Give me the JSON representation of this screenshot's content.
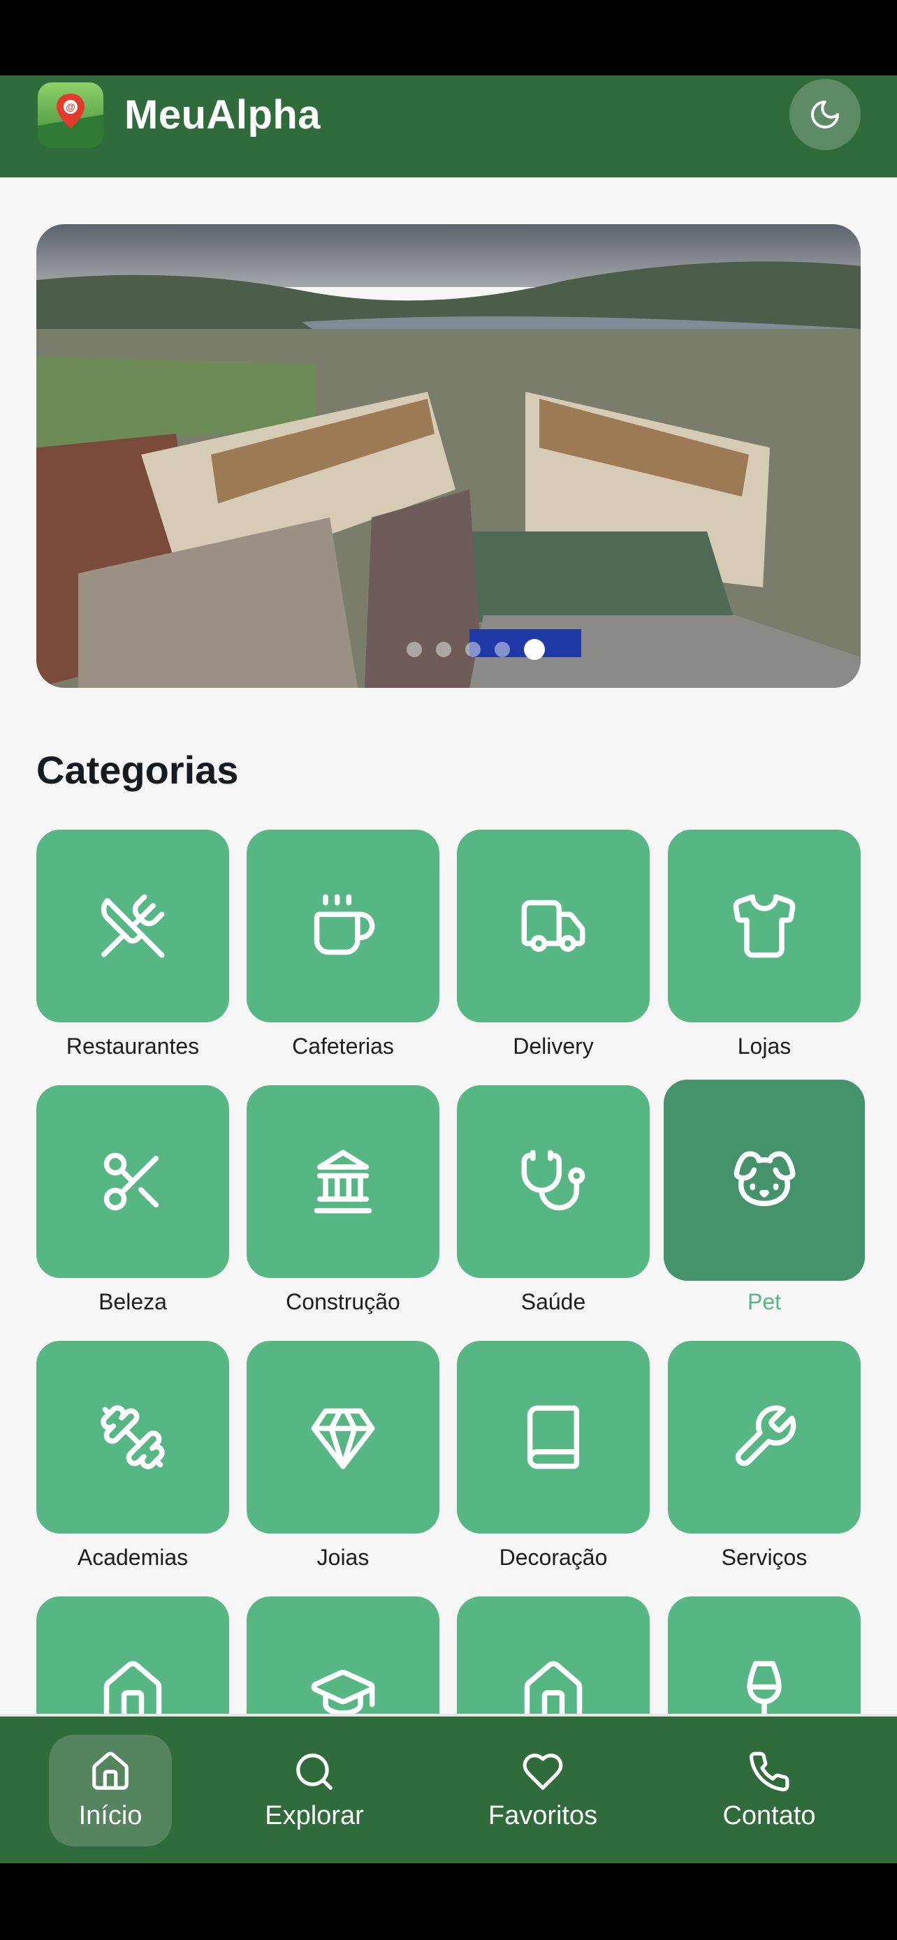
{
  "app": {
    "title": "MeuAlpha",
    "accent": "#56b684",
    "header_color": "#2f6b3b"
  },
  "header": {
    "logo_icon": "map-pin-logo-icon",
    "theme_toggle_icon": "moon-icon"
  },
  "hero": {
    "image_description_icon": "campus-photo",
    "slides_total": 5,
    "active_slide": 5
  },
  "categories": {
    "title": "Categorias",
    "items": [
      {
        "label": "Restaurantes",
        "icon": "utensils-crossed-icon"
      },
      {
        "label": "Cafeterias",
        "icon": "coffee-icon"
      },
      {
        "label": "Delivery",
        "icon": "truck-icon"
      },
      {
        "label": "Lojas",
        "icon": "shirt-icon"
      },
      {
        "label": "Beleza",
        "icon": "scissors-icon"
      },
      {
        "label": "Construção",
        "icon": "landmark-icon"
      },
      {
        "label": "Saúde",
        "icon": "stethoscope-icon"
      },
      {
        "label": "Pet",
        "icon": "dog-icon",
        "selected": true
      },
      {
        "label": "Academias",
        "icon": "dumbbell-icon"
      },
      {
        "label": "Joias",
        "icon": "gem-icon"
      },
      {
        "label": "Decoração",
        "icon": "book-icon"
      },
      {
        "label": "Serviços",
        "icon": "wrench-icon"
      },
      {
        "label": "",
        "icon": "home-icon"
      },
      {
        "label": "",
        "icon": "graduation-cap-icon"
      },
      {
        "label": "",
        "icon": "home-icon"
      },
      {
        "label": "",
        "icon": "wine-icon"
      }
    ]
  },
  "nav": {
    "items": [
      {
        "label": "Início",
        "icon": "home-icon",
        "active": true
      },
      {
        "label": "Explorar",
        "icon": "search-icon"
      },
      {
        "label": "Favoritos",
        "icon": "heart-icon"
      },
      {
        "label": "Contato",
        "icon": "phone-icon"
      }
    ]
  }
}
